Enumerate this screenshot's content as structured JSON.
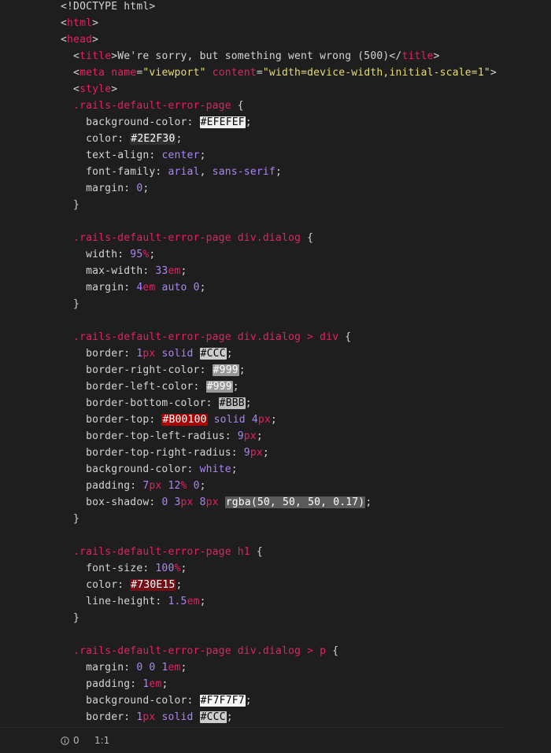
{
  "editor": {
    "lines": [
      [
        {
          "t": "<!DOCTYPE html>",
          "c": "plain"
        }
      ],
      [
        {
          "t": "<",
          "c": "plain"
        },
        {
          "t": "html",
          "c": "tag"
        },
        {
          "t": ">",
          "c": "plain"
        }
      ],
      [
        {
          "t": "<",
          "c": "plain"
        },
        {
          "t": "head",
          "c": "tag"
        },
        {
          "t": ">",
          "c": "plain"
        }
      ],
      [
        {
          "t": "  <",
          "c": "plain"
        },
        {
          "t": "title",
          "c": "tag"
        },
        {
          "t": ">We're sorry, but something went wrong (500)</",
          "c": "plain"
        },
        {
          "t": "title",
          "c": "tag"
        },
        {
          "t": ">",
          "c": "plain"
        }
      ],
      [
        {
          "t": "  <",
          "c": "plain"
        },
        {
          "t": "meta",
          "c": "tag"
        },
        {
          "t": " ",
          "c": "plain"
        },
        {
          "t": "name",
          "c": "attr"
        },
        {
          "t": "=",
          "c": "plain"
        },
        {
          "t": "\"viewport\"",
          "c": "string"
        },
        {
          "t": " ",
          "c": "plain"
        },
        {
          "t": "content",
          "c": "attr"
        },
        {
          "t": "=",
          "c": "plain"
        },
        {
          "t": "\"width=device-width,initial-scale=1\"",
          "c": "string"
        },
        {
          "t": ">",
          "c": "plain"
        }
      ],
      [
        {
          "t": "  <",
          "c": "plain"
        },
        {
          "t": "style",
          "c": "tag"
        },
        {
          "t": ">",
          "c": "plain"
        }
      ],
      [
        {
          "t": "  ",
          "c": "plain"
        },
        {
          "t": ".rails-default-error-page",
          "c": "selector"
        },
        {
          "t": " {",
          "c": "plain"
        }
      ],
      [
        {
          "t": "    background-color: ",
          "c": "plain"
        },
        {
          "t": "#EFEFEF",
          "c": "swatch",
          "bg": "#EFEFEF",
          "fg": "#000000"
        },
        {
          "t": ";",
          "c": "plain"
        }
      ],
      [
        {
          "t": "    color: ",
          "c": "plain"
        },
        {
          "t": "#2E2F30",
          "c": "swatch",
          "bg": "#2E2F30",
          "fg": "#FFFFFF"
        },
        {
          "t": ";",
          "c": "plain"
        }
      ],
      [
        {
          "t": "    text-align: ",
          "c": "plain"
        },
        {
          "t": "center",
          "c": "keyword"
        },
        {
          "t": ";",
          "c": "plain"
        }
      ],
      [
        {
          "t": "    font-family: ",
          "c": "plain"
        },
        {
          "t": "arial",
          "c": "keyword"
        },
        {
          "t": ", ",
          "c": "plain"
        },
        {
          "t": "sans-serif",
          "c": "keyword"
        },
        {
          "t": ";",
          "c": "plain"
        }
      ],
      [
        {
          "t": "    margin: ",
          "c": "plain"
        },
        {
          "t": "0",
          "c": "number"
        },
        {
          "t": ";",
          "c": "plain"
        }
      ],
      [
        {
          "t": "  }",
          "c": "plain"
        }
      ],
      [
        {
          "t": "",
          "c": "plain"
        }
      ],
      [
        {
          "t": "  ",
          "c": "plain"
        },
        {
          "t": ".rails-default-error-page",
          "c": "selector"
        },
        {
          "t": " ",
          "c": "plain"
        },
        {
          "t": "div.dialog",
          "c": "selector"
        },
        {
          "t": " {",
          "c": "plain"
        }
      ],
      [
        {
          "t": "    width: ",
          "c": "plain"
        },
        {
          "t": "95",
          "c": "number"
        },
        {
          "t": "%",
          "c": "unit"
        },
        {
          "t": ";",
          "c": "plain"
        }
      ],
      [
        {
          "t": "    max-width: ",
          "c": "plain"
        },
        {
          "t": "33",
          "c": "number"
        },
        {
          "t": "em",
          "c": "unit"
        },
        {
          "t": ";",
          "c": "plain"
        }
      ],
      [
        {
          "t": "    margin: ",
          "c": "plain"
        },
        {
          "t": "4",
          "c": "number"
        },
        {
          "t": "em",
          "c": "unit"
        },
        {
          "t": " ",
          "c": "plain"
        },
        {
          "t": "auto",
          "c": "keyword"
        },
        {
          "t": " ",
          "c": "plain"
        },
        {
          "t": "0",
          "c": "number"
        },
        {
          "t": ";",
          "c": "plain"
        }
      ],
      [
        {
          "t": "  }",
          "c": "plain"
        }
      ],
      [
        {
          "t": "",
          "c": "plain"
        }
      ],
      [
        {
          "t": "  ",
          "c": "plain"
        },
        {
          "t": ".rails-default-error-page",
          "c": "selector"
        },
        {
          "t": " ",
          "c": "plain"
        },
        {
          "t": "div.dialog",
          "c": "selector"
        },
        {
          "t": " > ",
          "c": "selector"
        },
        {
          "t": "div",
          "c": "selector"
        },
        {
          "t": " {",
          "c": "plain"
        }
      ],
      [
        {
          "t": "    border: ",
          "c": "plain"
        },
        {
          "t": "1",
          "c": "number"
        },
        {
          "t": "px",
          "c": "unit"
        },
        {
          "t": " ",
          "c": "plain"
        },
        {
          "t": "solid",
          "c": "keyword"
        },
        {
          "t": " ",
          "c": "plain"
        },
        {
          "t": "#CCC",
          "c": "swatch",
          "bg": "#CCCCCC",
          "fg": "#000000"
        },
        {
          "t": ";",
          "c": "plain"
        }
      ],
      [
        {
          "t": "    border-right-color: ",
          "c": "plain"
        },
        {
          "t": "#999",
          "c": "swatch",
          "bg": "#999999",
          "fg": "#FFFFFF"
        },
        {
          "t": ";",
          "c": "plain"
        }
      ],
      [
        {
          "t": "    border-left-color: ",
          "c": "plain"
        },
        {
          "t": "#999",
          "c": "swatch",
          "bg": "#999999",
          "fg": "#FFFFFF"
        },
        {
          "t": ";",
          "c": "plain"
        }
      ],
      [
        {
          "t": "    border-bottom-color: ",
          "c": "plain"
        },
        {
          "t": "#BBB",
          "c": "swatch",
          "bg": "#BBBBBB",
          "fg": "#000000"
        },
        {
          "t": ";",
          "c": "plain"
        }
      ],
      [
        {
          "t": "    border-top: ",
          "c": "plain"
        },
        {
          "t": "#B00100",
          "c": "swatch",
          "bg": "#B00100",
          "fg": "#FFFFFF"
        },
        {
          "t": " ",
          "c": "plain"
        },
        {
          "t": "solid",
          "c": "keyword"
        },
        {
          "t": " ",
          "c": "plain"
        },
        {
          "t": "4",
          "c": "number"
        },
        {
          "t": "px",
          "c": "unit"
        },
        {
          "t": ";",
          "c": "plain"
        }
      ],
      [
        {
          "t": "    border-top-left-radius: ",
          "c": "plain"
        },
        {
          "t": "9",
          "c": "number"
        },
        {
          "t": "px",
          "c": "unit"
        },
        {
          "t": ";",
          "c": "plain"
        }
      ],
      [
        {
          "t": "    border-top-right-radius: ",
          "c": "plain"
        },
        {
          "t": "9",
          "c": "number"
        },
        {
          "t": "px",
          "c": "unit"
        },
        {
          "t": ";",
          "c": "plain"
        }
      ],
      [
        {
          "t": "    background-color: ",
          "c": "plain"
        },
        {
          "t": "white",
          "c": "keyword"
        },
        {
          "t": ";",
          "c": "plain"
        }
      ],
      [
        {
          "t": "    padding: ",
          "c": "plain"
        },
        {
          "t": "7",
          "c": "number"
        },
        {
          "t": "px",
          "c": "unit"
        },
        {
          "t": " ",
          "c": "plain"
        },
        {
          "t": "12",
          "c": "number"
        },
        {
          "t": "%",
          "c": "unit"
        },
        {
          "t": " ",
          "c": "plain"
        },
        {
          "t": "0",
          "c": "number"
        },
        {
          "t": ";",
          "c": "plain"
        }
      ],
      [
        {
          "t": "    box-shadow: ",
          "c": "plain"
        },
        {
          "t": "0",
          "c": "number"
        },
        {
          "t": " ",
          "c": "plain"
        },
        {
          "t": "3",
          "c": "number"
        },
        {
          "t": "px",
          "c": "unit"
        },
        {
          "t": " ",
          "c": "plain"
        },
        {
          "t": "8",
          "c": "number"
        },
        {
          "t": "px",
          "c": "unit"
        },
        {
          "t": " ",
          "c": "plain"
        },
        {
          "t": "rgba(50, 50, 50, 0.17)",
          "c": "swatch",
          "bg": "#5a5a5a",
          "fg": "#FFFFFF"
        },
        {
          "t": ";",
          "c": "plain"
        }
      ],
      [
        {
          "t": "  }",
          "c": "plain"
        }
      ],
      [
        {
          "t": "",
          "c": "plain"
        }
      ],
      [
        {
          "t": "  ",
          "c": "plain"
        },
        {
          "t": ".rails-default-error-page",
          "c": "selector"
        },
        {
          "t": " ",
          "c": "plain"
        },
        {
          "t": "h1",
          "c": "selector"
        },
        {
          "t": " {",
          "c": "plain"
        }
      ],
      [
        {
          "t": "    font-size: ",
          "c": "plain"
        },
        {
          "t": "100",
          "c": "number"
        },
        {
          "t": "%",
          "c": "unit"
        },
        {
          "t": ";",
          "c": "plain"
        }
      ],
      [
        {
          "t": "    color: ",
          "c": "plain"
        },
        {
          "t": "#730E15",
          "c": "swatch",
          "bg": "#730E15",
          "fg": "#FFFFFF"
        },
        {
          "t": ";",
          "c": "plain"
        }
      ],
      [
        {
          "t": "    line-height: ",
          "c": "plain"
        },
        {
          "t": "1.5",
          "c": "number"
        },
        {
          "t": "em",
          "c": "unit"
        },
        {
          "t": ";",
          "c": "plain"
        }
      ],
      [
        {
          "t": "  }",
          "c": "plain"
        }
      ],
      [
        {
          "t": "",
          "c": "plain"
        }
      ],
      [
        {
          "t": "  ",
          "c": "plain"
        },
        {
          "t": ".rails-default-error-page",
          "c": "selector"
        },
        {
          "t": " ",
          "c": "plain"
        },
        {
          "t": "div.dialog",
          "c": "selector"
        },
        {
          "t": " > ",
          "c": "selector"
        },
        {
          "t": "p",
          "c": "selector"
        },
        {
          "t": " {",
          "c": "plain"
        }
      ],
      [
        {
          "t": "    margin: ",
          "c": "plain"
        },
        {
          "t": "0",
          "c": "number"
        },
        {
          "t": " ",
          "c": "plain"
        },
        {
          "t": "0",
          "c": "number"
        },
        {
          "t": " ",
          "c": "plain"
        },
        {
          "t": "1",
          "c": "number"
        },
        {
          "t": "em",
          "c": "unit"
        },
        {
          "t": ";",
          "c": "plain"
        }
      ],
      [
        {
          "t": "    padding: ",
          "c": "plain"
        },
        {
          "t": "1",
          "c": "number"
        },
        {
          "t": "em",
          "c": "unit"
        },
        {
          "t": ";",
          "c": "plain"
        }
      ],
      [
        {
          "t": "    background-color: ",
          "c": "plain"
        },
        {
          "t": "#F7F7F7",
          "c": "swatch",
          "bg": "#F7F7F7",
          "fg": "#000000"
        },
        {
          "t": ";",
          "c": "plain"
        }
      ],
      [
        {
          "t": "    border: ",
          "c": "plain"
        },
        {
          "t": "1",
          "c": "number"
        },
        {
          "t": "px",
          "c": "unit"
        },
        {
          "t": " ",
          "c": "plain"
        },
        {
          "t": "solid",
          "c": "keyword"
        },
        {
          "t": " ",
          "c": "plain"
        },
        {
          "t": "#CCC",
          "c": "swatch",
          "bg": "#CCCCCC",
          "fg": "#000000"
        },
        {
          "t": ";",
          "c": "plain"
        }
      ]
    ]
  },
  "status_bar": {
    "problems_icon": "info-icon",
    "problems_count": "0",
    "cursor_position": "1:1"
  },
  "colors": {
    "background": "#1e1e1e",
    "plain": "#d4d4d4",
    "tag_selector": "#e91e63",
    "number_keyword": "#ae81ff",
    "string": "#e6db74"
  }
}
